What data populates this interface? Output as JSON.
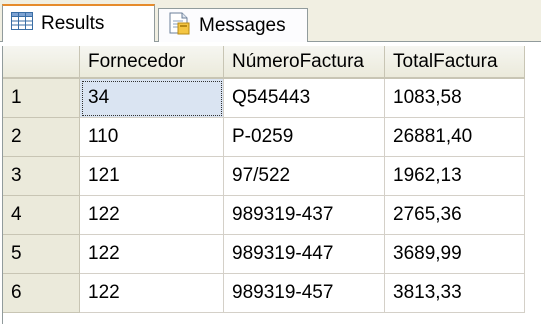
{
  "tabs": [
    {
      "label": "Results",
      "icon": "grid-icon",
      "active": true
    },
    {
      "label": "Messages",
      "icon": "messages-icon",
      "active": false
    }
  ],
  "grid": {
    "columns": [
      "",
      "Fornecedor",
      "NúmeroFactura",
      "TotalFactura"
    ],
    "rows": [
      {
        "n": "1",
        "fornecedor": "34",
        "numero": "Q545443",
        "total": "1083,58"
      },
      {
        "n": "2",
        "fornecedor": "110",
        "numero": "P-0259",
        "total": "26881,40"
      },
      {
        "n": "3",
        "fornecedor": "121",
        "numero": "97/522",
        "total": "1962,13"
      },
      {
        "n": "4",
        "fornecedor": "122",
        "numero": "989319-437",
        "total": "2765,36"
      },
      {
        "n": "5",
        "fornecedor": "122",
        "numero": "989319-447",
        "total": "3689,99"
      },
      {
        "n": "6",
        "fornecedor": "122",
        "numero": "989319-457",
        "total": "3813,33"
      }
    ]
  },
  "colors": {
    "tab_accent": "#e68b2c",
    "header_bg": "#ebeadb",
    "selection_bg": "#dae4f2"
  }
}
